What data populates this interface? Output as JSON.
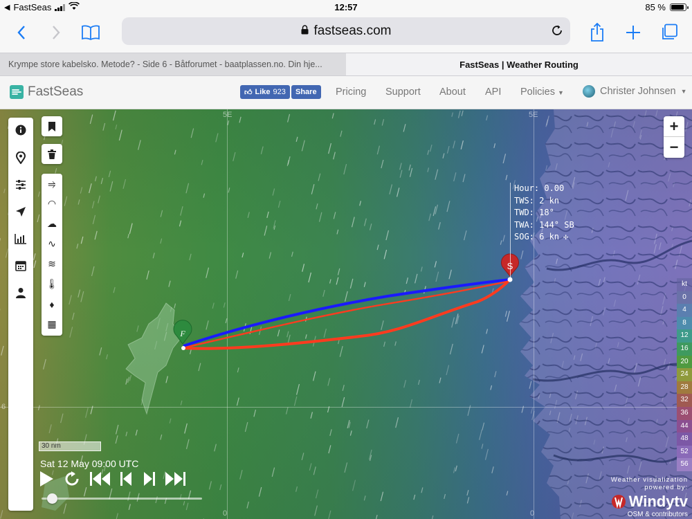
{
  "status": {
    "carrier": "FastSeas",
    "time": "12:57",
    "battery": "85 %"
  },
  "browser": {
    "url": "fastseas.com",
    "tabs": [
      {
        "label": "Krympe store kabelsko. Metode? - Side 6 - Båtforumet - baatplassen.no. Din hje..."
      },
      {
        "label": "FastSeas | Weather Routing"
      }
    ]
  },
  "site": {
    "brand": "FastSeas",
    "fb_like": "Like",
    "fb_count": "923",
    "fb_share": "Share",
    "nav": [
      "Pricing",
      "Support",
      "About",
      "API",
      "Policies"
    ],
    "user": "Christer Johnsen"
  },
  "map": {
    "grid_labels": [
      "5E",
      "5E",
      "6",
      "0",
      "0"
    ],
    "start_marker": "F",
    "end_marker": "S",
    "info": {
      "hour": "Hour: 0.00",
      "tws": "TWS: 2 kn",
      "twd": "TWD: 18°",
      "twa": "TWA: 144° SB",
      "sog": "SOG: 6 kn"
    },
    "legend": {
      "unit": "kt",
      "values": [
        "0",
        "4",
        "8",
        "12",
        "16",
        "20",
        "24",
        "28",
        "32",
        "36",
        "44",
        "48",
        "52",
        "56"
      ],
      "colors": [
        "#6a72a8",
        "#5b7fb0",
        "#4e8cad",
        "#3f9b8a",
        "#3f9a5f",
        "#4f9a40",
        "#8f9a3c",
        "#a07a3e",
        "#a05a52",
        "#9c4f72",
        "#8b4f91",
        "#7c58a6",
        "#8a6ab8",
        "#9a7fc4"
      ]
    },
    "route_colors": {
      "blue": "#1a1aff",
      "red": "#ff3b1f"
    },
    "scale": "30 nm",
    "datetime": "Sat 12 May 09:00 UTC",
    "windy_caption_1": "Weather visualization",
    "windy_caption_2": "powered by:",
    "windy_brand": "Windytv",
    "windy_osm": "OSM & contributors"
  }
}
